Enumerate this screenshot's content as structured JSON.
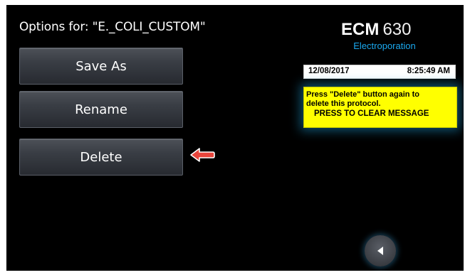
{
  "options": {
    "title": "Options for: \"E._COLI_CUSTOM\""
  },
  "menu": {
    "save_as_label": "Save As",
    "rename_label": "Rename",
    "delete_label": "Delete"
  },
  "brand": {
    "name": "ECM",
    "model": "630",
    "subtitle": "Electroporation"
  },
  "status": {
    "date": "12/08/2017",
    "time": "8:25:49 AM"
  },
  "message": {
    "line1": "Press \"Delete\" button again to",
    "line2": "delete this protocol.",
    "line3": "PRESS TO CLEAR MESSAGE"
  },
  "icons": {
    "pointer": "red-arrow-left-icon",
    "back": "back-arrow-icon"
  },
  "colors": {
    "screen_bg": "#000000",
    "accent_blue": "#1aa8ee",
    "message_bg": "#ffff00",
    "pointer_red": "#e8453c"
  }
}
